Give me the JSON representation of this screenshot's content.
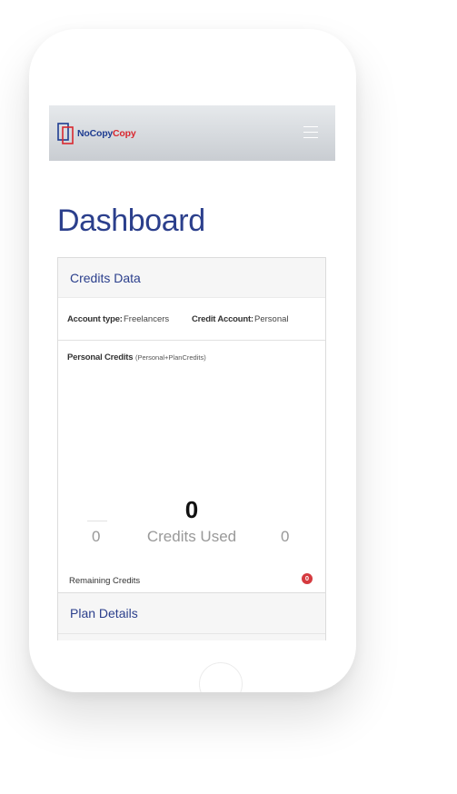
{
  "brand": {
    "name_part1": "NoCopy",
    "name_part2": "Copy",
    "primary_color": "#1f3d91",
    "accent_color": "#d9282f"
  },
  "navbar": {
    "menu_icon": "hamburger-menu-icon"
  },
  "page": {
    "title": "Dashboard"
  },
  "credits_card": {
    "title": "Credits Data",
    "account_type_label": "Account type:",
    "account_type_value": "Freelancers",
    "credit_account_label": "Credit Account:",
    "credit_account_value": "Personal",
    "personal_credits_label": "Personal Credits",
    "personal_credits_sub": "(Personal+PlanCredits)",
    "credits_used_value": "0",
    "credits_used_label": "Credits Used",
    "left_value": "0",
    "right_value": "0",
    "remaining_label": "Remaining Credits",
    "remaining_badge": "0",
    "badge_color": "#d53a3f"
  },
  "plan_card": {
    "title": "Plan Details"
  }
}
